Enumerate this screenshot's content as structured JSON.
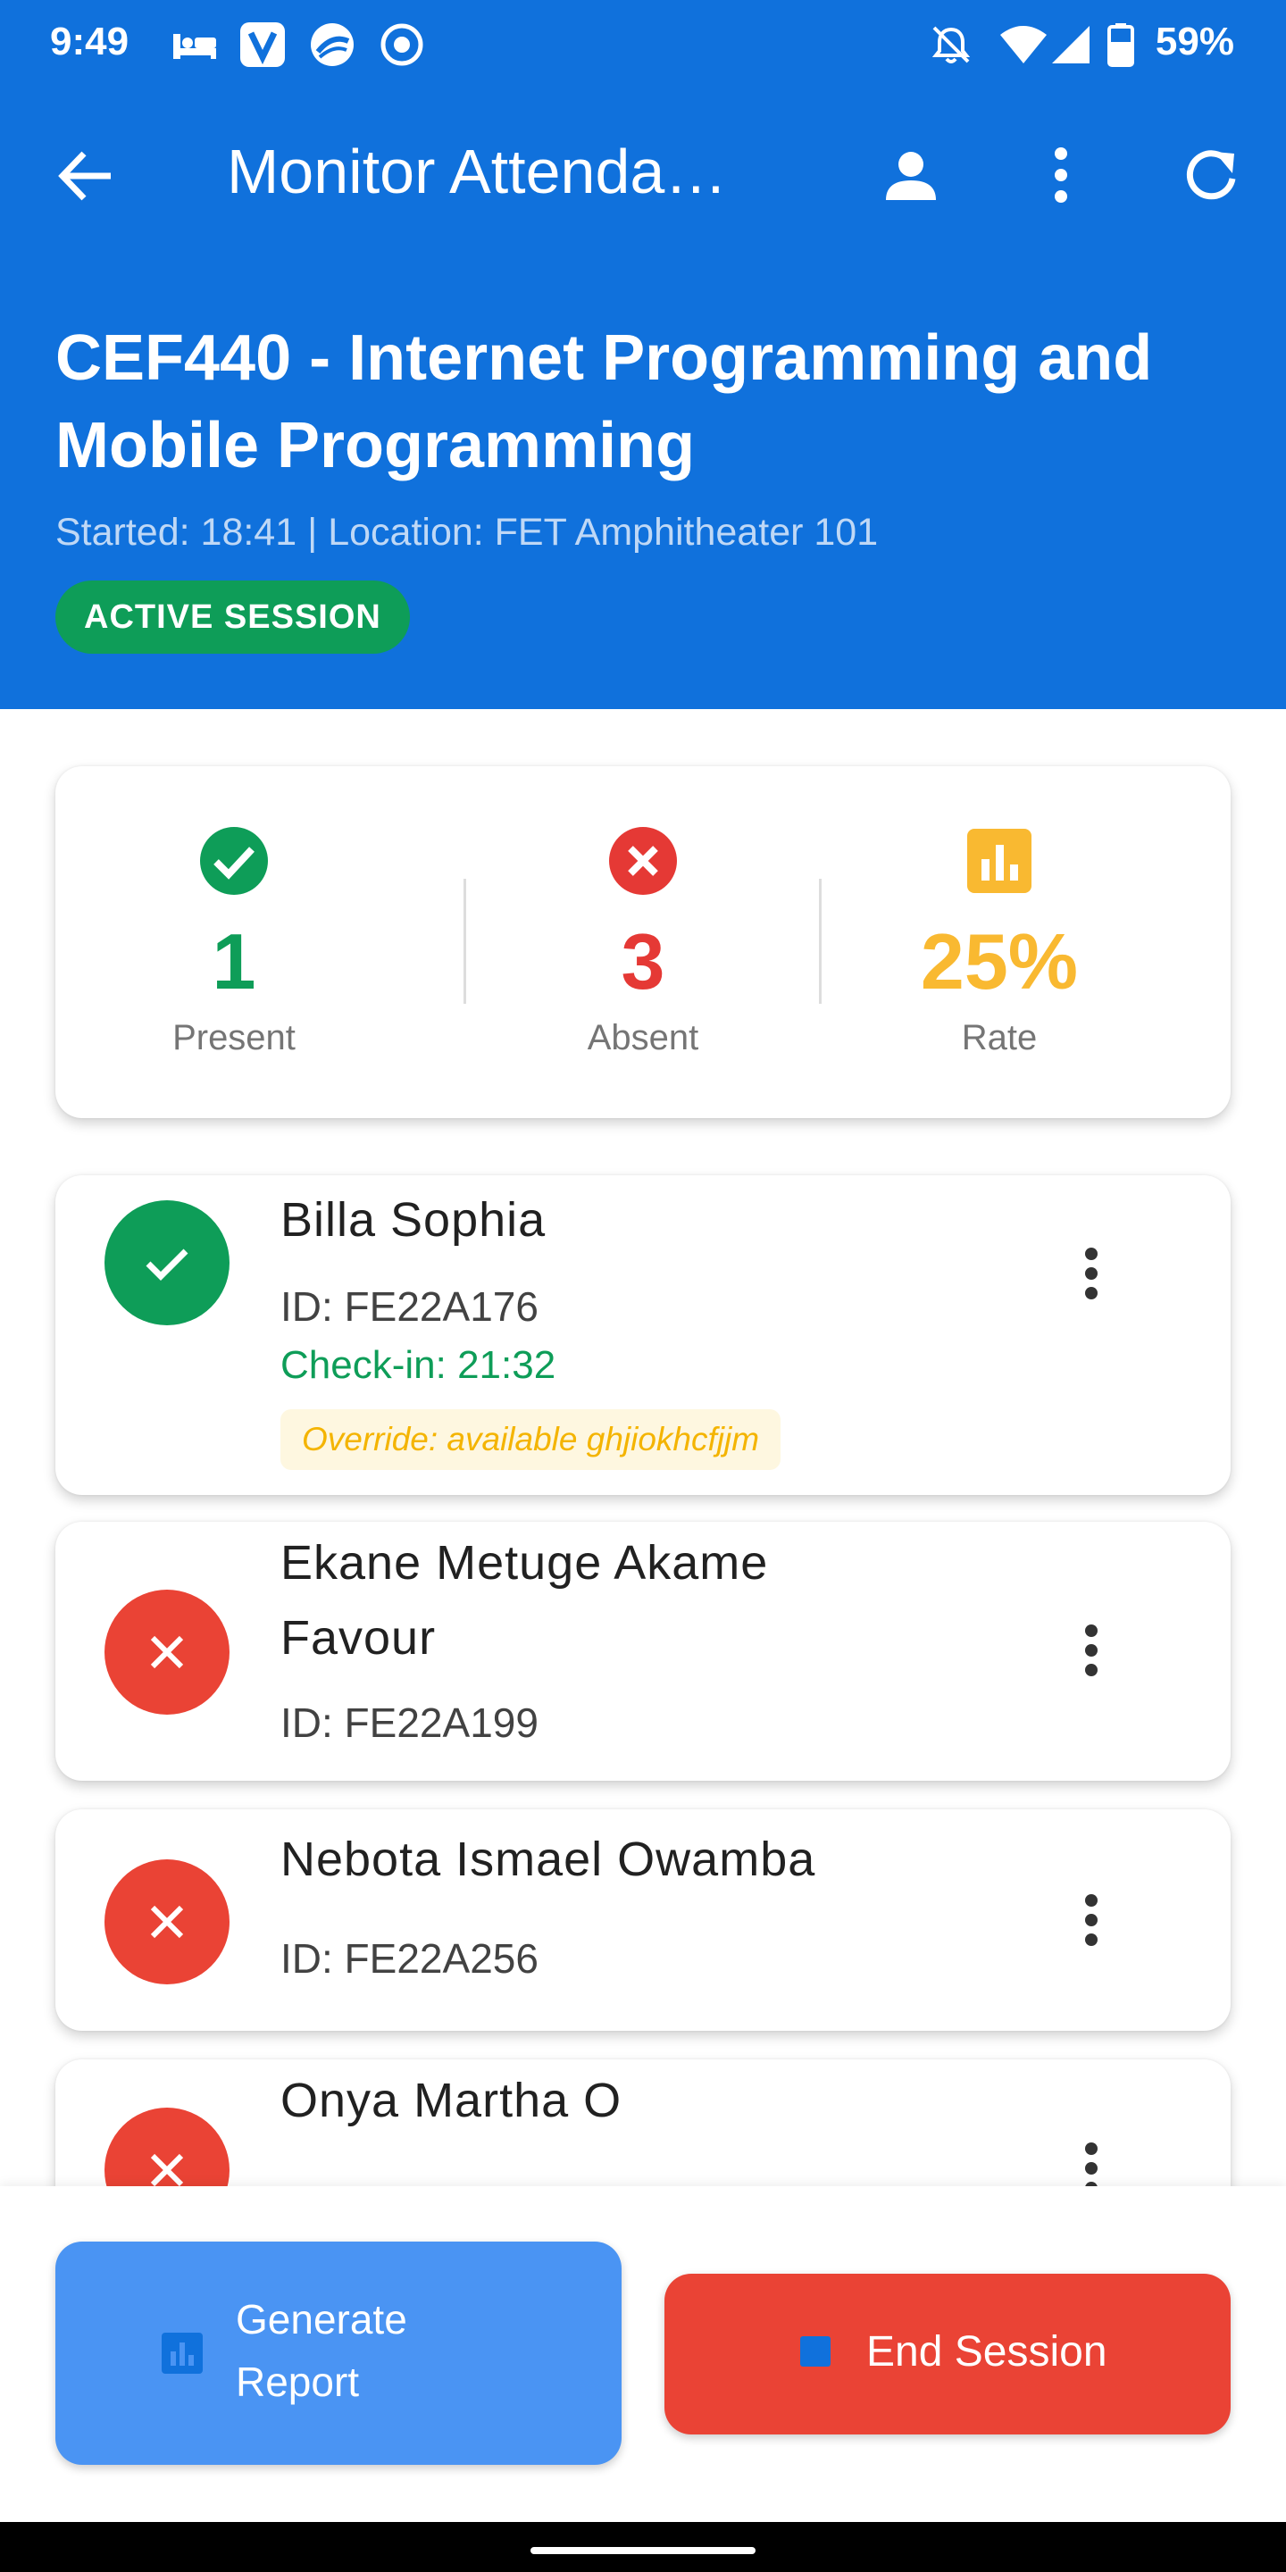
{
  "status_bar": {
    "time": "9:49",
    "battery": "59%",
    "left_icons": [
      "hotel-icon",
      "v-app-icon",
      "swirl-app-icon",
      "record-icon"
    ],
    "right_icons": [
      "alarm-off-icon",
      "wifi-icon",
      "signal-icon",
      "battery-icon"
    ]
  },
  "app_bar": {
    "title": "Monitor Attenda…",
    "icons": [
      "back-arrow-icon",
      "person-icon",
      "more-vert-icon",
      "refresh-icon"
    ]
  },
  "header": {
    "course_title": "CEF440 - Internet Programming and Mobile Programming",
    "session_meta": "Started: 18:41 | Location: FET Amphitheater 101",
    "status_badge": "ACTIVE SESSION"
  },
  "stats": {
    "present": {
      "value": "1",
      "label": "Present",
      "color": "#0E9D58"
    },
    "absent": {
      "value": "3",
      "label": "Absent",
      "color": "#E53935"
    },
    "rate": {
      "value": "25%",
      "label": "Rate",
      "color": "#F9B931"
    }
  },
  "students": [
    {
      "name": "Billa Sophia",
      "id": "ID: FE22A176",
      "status": "present",
      "check_in": "Check-in: 21:32",
      "override": "Override: available ghjiokhcfjjm"
    },
    {
      "name": "Ekane Metuge Akame Favour",
      "id": "ID: FE22A199",
      "status": "absent"
    },
    {
      "name": "Nebota Ismael Owamba",
      "id": "ID: FE22A256",
      "status": "absent"
    },
    {
      "name": "Onya Martha O",
      "status": "absent"
    }
  ],
  "actions": {
    "generate_report": "Generate Report",
    "end_session": "End Session"
  },
  "colors": {
    "primary": "#1071DC",
    "present": "#0E9D58",
    "absent": "#EA4335",
    "rate": "#F9B931",
    "report_button": "#4A94F3"
  }
}
